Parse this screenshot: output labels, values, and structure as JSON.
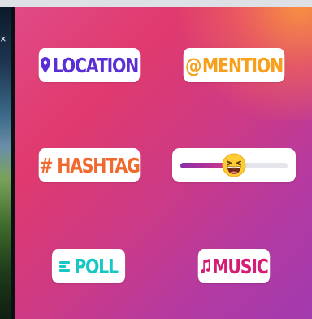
{
  "background_photo": {
    "close_glyph": "×"
  },
  "stickers": {
    "location": {
      "label": "LOCATION",
      "icon": "location-pin-icon",
      "color": "#5a2fd6"
    },
    "mention": {
      "prefix": "@",
      "label": "MENTION",
      "color": "#f6a01d"
    },
    "hashtag": {
      "label": "# HASHTAG",
      "color": "#f06a2f"
    },
    "slider": {
      "emoji": "grinning-squinting-face-icon",
      "level": 0.5
    },
    "poll": {
      "label": "POLL",
      "icon": "poll-lines-icon",
      "color": "#18c6c3"
    },
    "music": {
      "label": "MUSIC",
      "icon": "music-note-icon",
      "color": "#d61d75"
    }
  },
  "colors": {
    "tray_gradient_start": "#e04a86",
    "tray_gradient_end": "#a23aae",
    "tray_corner_glow": "#f6963c"
  }
}
